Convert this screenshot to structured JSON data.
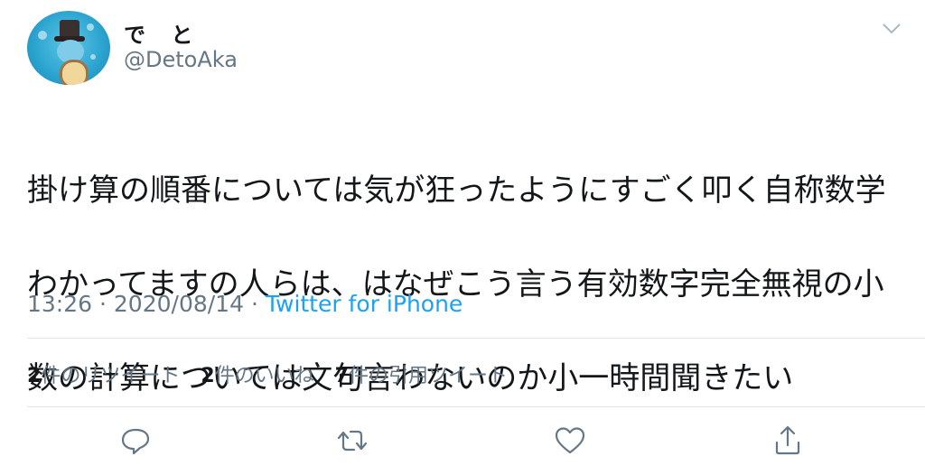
{
  "user": {
    "display_name": "で と",
    "handle": "@DetoAka"
  },
  "tweet": {
    "text_lines": [
      "掛け算の順番については気が狂ったようにすごく叩く自称数学",
      "わかってますの人らは、はなぜこう言う有効数字完全無視の小",
      "数の計算については文句言わないのか小一時間聞きたい"
    ],
    "time": "13:26",
    "date": "2020/08/14",
    "separator": "·",
    "client": "Twitter for iPhone"
  },
  "stats": {
    "retweets": {
      "count": "2",
      "label": "件のリツイート"
    },
    "likes": {
      "count": "2",
      "label": "件のいいね"
    },
    "quotes": {
      "count": "7",
      "label": "件の引用ツイート"
    }
  },
  "icons": {
    "avatar": "squirtle-with-top-hat",
    "menu": "chevron-down-icon",
    "reply": "comment-bubble-icon",
    "retweet": "retweet-arrows-icon",
    "like": "heart-icon",
    "share": "share-upload-icon"
  },
  "colors": {
    "text": "#14171a",
    "secondary": "#657786",
    "link": "#1da1f2",
    "divider": "#e1e8ed"
  }
}
